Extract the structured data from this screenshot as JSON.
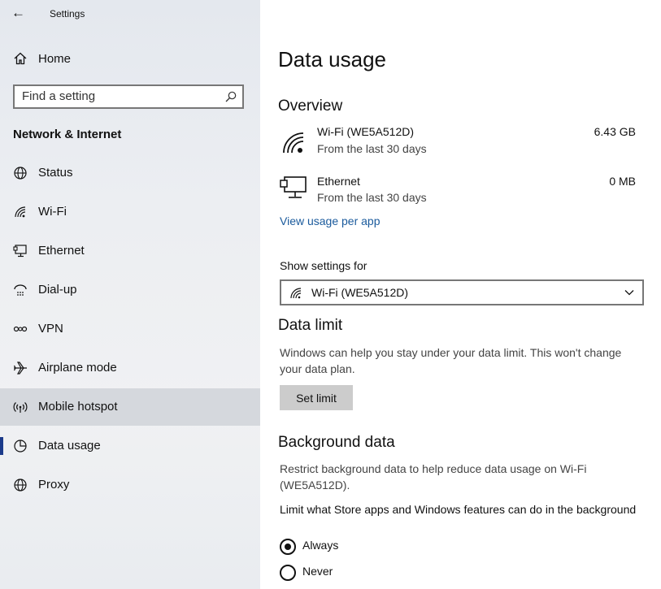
{
  "window": {
    "title": "Settings"
  },
  "sidebar": {
    "home_label": "Home",
    "search_placeholder": "Find a setting",
    "section_title": "Network & Internet",
    "items": [
      {
        "label": "Status",
        "icon": "globe-icon"
      },
      {
        "label": "Wi-Fi",
        "icon": "wifi-icon"
      },
      {
        "label": "Ethernet",
        "icon": "ethernet-icon"
      },
      {
        "label": "Dial-up",
        "icon": "dialup-icon"
      },
      {
        "label": "VPN",
        "icon": "vpn-icon"
      },
      {
        "label": "Airplane mode",
        "icon": "airplane-icon"
      },
      {
        "label": "Mobile hotspot",
        "icon": "hotspot-icon"
      },
      {
        "label": "Data usage",
        "icon": "pie-chart-icon"
      },
      {
        "label": "Proxy",
        "icon": "globe-icon"
      }
    ],
    "hover_item": "Mobile hotspot",
    "selected_item": "Data usage"
  },
  "main": {
    "title": "Data usage",
    "overview": {
      "heading": "Overview",
      "networks": [
        {
          "name": "Wi-Fi (WE5A512D)",
          "sub": "From the last 30 days",
          "value": "6.43 GB",
          "icon": "wifi-icon"
        },
        {
          "name": "Ethernet",
          "sub": "From the last 30 days",
          "value": "0 MB",
          "icon": "ethernet-icon"
        }
      ],
      "link": "View usage per app"
    },
    "show_settings": {
      "label": "Show settings for",
      "selected": "Wi-Fi (WE5A512D)"
    },
    "data_limit": {
      "heading": "Data limit",
      "description": "Windows can help you stay under your data limit. This won't change your data plan.",
      "button": "Set limit"
    },
    "background": {
      "heading": "Background data",
      "description": "Restrict background data to help reduce data usage on Wi-Fi (WE5A512D).",
      "question": "Limit what Store apps and Windows features can do in the background",
      "options": [
        {
          "label": "Always",
          "selected": true
        },
        {
          "label": "Never",
          "selected": false
        }
      ]
    }
  },
  "colors": {
    "accent": "#1b3a8a",
    "link": "#1a5a9c",
    "hover": "#d5d8dd"
  }
}
